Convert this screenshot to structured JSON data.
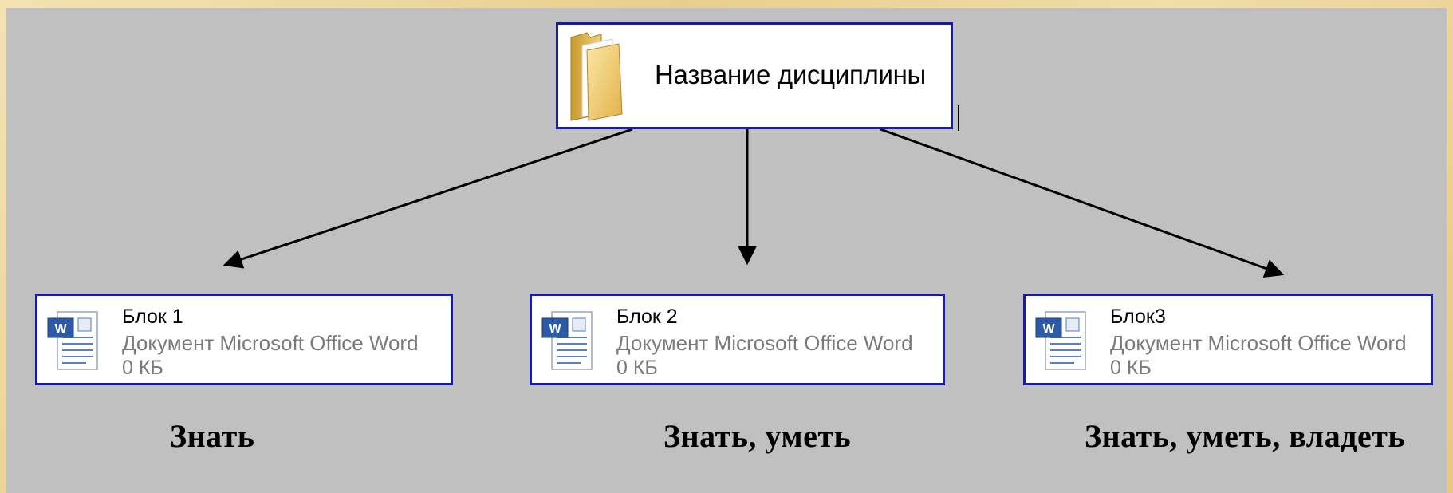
{
  "root": {
    "label": "Название дисциплины",
    "icon": "folder-icon"
  },
  "blocks": [
    {
      "name": "Блок 1",
      "type": "Документ Microsoft Office Word",
      "size": "0 КБ",
      "icon": "word-document-icon",
      "caption": "Знать"
    },
    {
      "name": "Блок 2",
      "type": "Документ Microsoft Office Word",
      "size": "0 КБ",
      "icon": "word-document-icon",
      "caption": "Знать, уметь"
    },
    {
      "name": "Блок3",
      "type": "Документ Microsoft Office Word",
      "size": "0 КБ",
      "icon": "word-document-icon",
      "caption": "Знать, уметь, владеть"
    }
  ],
  "colors": {
    "node_border": "#1a1aa8",
    "panel_background": "#c0c0c0",
    "secondary_text": "#7a7a7a"
  }
}
